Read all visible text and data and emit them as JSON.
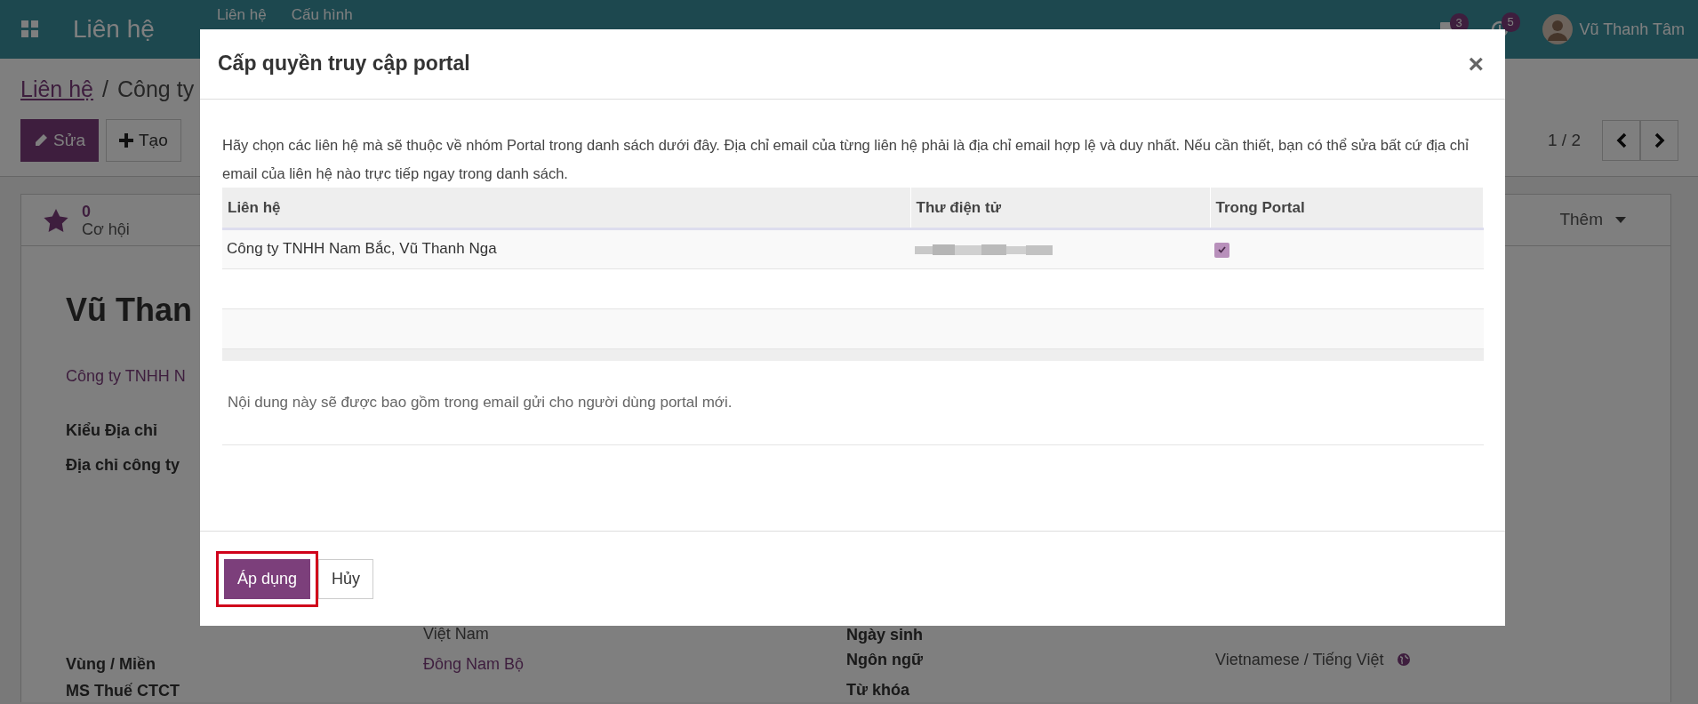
{
  "navbar": {
    "app_title": "Liên hệ",
    "menu": [
      {
        "label": "Liên hệ"
      },
      {
        "label": "Cấu hình"
      }
    ],
    "messages_badge": "3",
    "activities_badge": "5",
    "user_name": "Vũ Thanh Tâm"
  },
  "breadcrumb": {
    "separator": "/",
    "items": [
      {
        "label": "Liên hệ"
      },
      {
        "label": "Công ty"
      }
    ]
  },
  "actions": [
    {
      "label": "Sửa",
      "kind": "edit"
    },
    {
      "label": "Tạo",
      "kind": "create"
    }
  ],
  "pager": {
    "text": "1 / 2"
  },
  "form": {
    "stat_button": {
      "value": "0",
      "label": "Cơ hội"
    },
    "more_button": "Thêm",
    "title": "Vũ Than",
    "company": "Công ty TNHH N",
    "left_labels": [
      "Kiểu Địa chỉ",
      "Địa chỉ công ty",
      "Vùng / Miền",
      "MS Thuế CTCT"
    ],
    "country": "Việt Nam",
    "region": "Đông Nam Bộ",
    "right_fields": [
      {
        "label": "Ngày sinh"
      },
      {
        "label": "Ngôn ngữ",
        "value": "Vietnamese / Tiếng Việt"
      },
      {
        "label": "Từ khóa"
      }
    ]
  },
  "dialog": {
    "title": "Cấp quyền truy cập portal",
    "close_label": "×",
    "intro": "Hãy chọn các liên hệ mà sẽ thuộc về nhóm Portal trong danh sách dưới đây. Địa chỉ email của từng liên hệ phải là địa chỉ email hợp lệ và duy nhất. Nếu cần thiết, bạn có thể sửa bất cứ địa chỉ email của liên hệ nào trực tiếp ngay trong danh sách.",
    "columns": [
      "Liên hệ",
      "Thư điện tử",
      "Trong Portal"
    ],
    "rows": [
      {
        "contact": "Công ty TNHH Nam Bắc, Vũ Thanh Nga",
        "in_portal": true
      }
    ],
    "note": "Nội dung này sẽ được bao gồm trong email gửi cho người dùng portal mới.",
    "buttons": [
      {
        "label": "Áp dụng",
        "kind": "primary",
        "highlighted": true
      },
      {
        "label": "Hủy",
        "kind": "secondary",
        "highlighted": false
      }
    ]
  }
}
